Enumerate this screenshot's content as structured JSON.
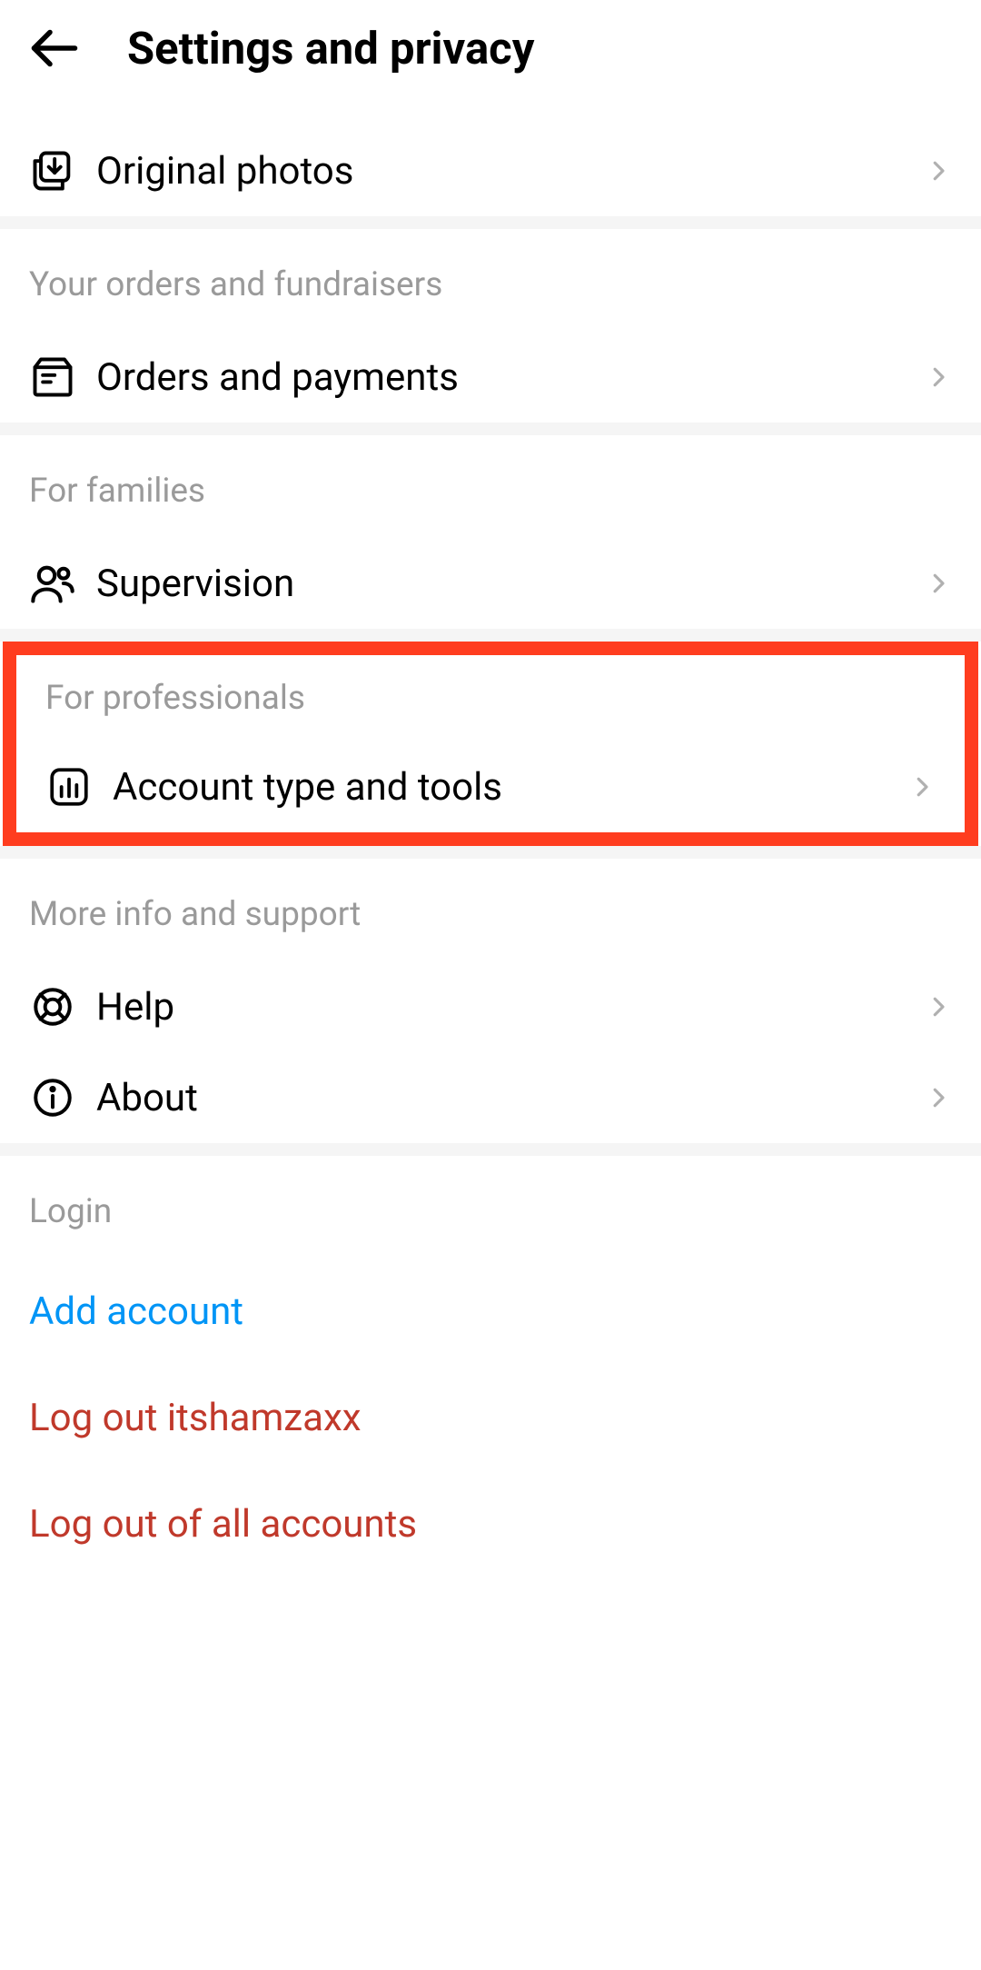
{
  "header": {
    "title": "Settings and privacy"
  },
  "rows": {
    "original_photos": "Original photos",
    "orders_payments": "Orders and payments",
    "supervision": "Supervision",
    "account_type_tools": "Account type and tools",
    "help": "Help",
    "about": "About"
  },
  "sections": {
    "orders": "Your orders and fundraisers",
    "families": "For families",
    "professionals": "For professionals",
    "support": "More info and support",
    "login": "Login"
  },
  "login": {
    "add_account": "Add account",
    "logout_user": "Log out itshamzaxx",
    "logout_all": "Log out of all accounts"
  }
}
